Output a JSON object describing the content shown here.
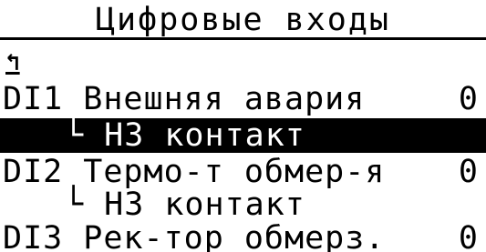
{
  "screen": {
    "title": "Цифровые входы",
    "back_icon": "↰"
  },
  "items": [
    {
      "label": "DI1 Внешняя авария",
      "value": "0"
    },
    {
      "sub": "└ НЗ контакт"
    },
    {
      "label": "DI2 Термо-т обмер-я",
      "value": "0"
    },
    {
      "sub": "└ НЗ контакт"
    },
    {
      "label": "DI3 Рек-тор обмерз.",
      "value": "0"
    }
  ],
  "colors": {
    "background": "#ffffff",
    "foreground": "#000000",
    "highlight": "#000000"
  }
}
